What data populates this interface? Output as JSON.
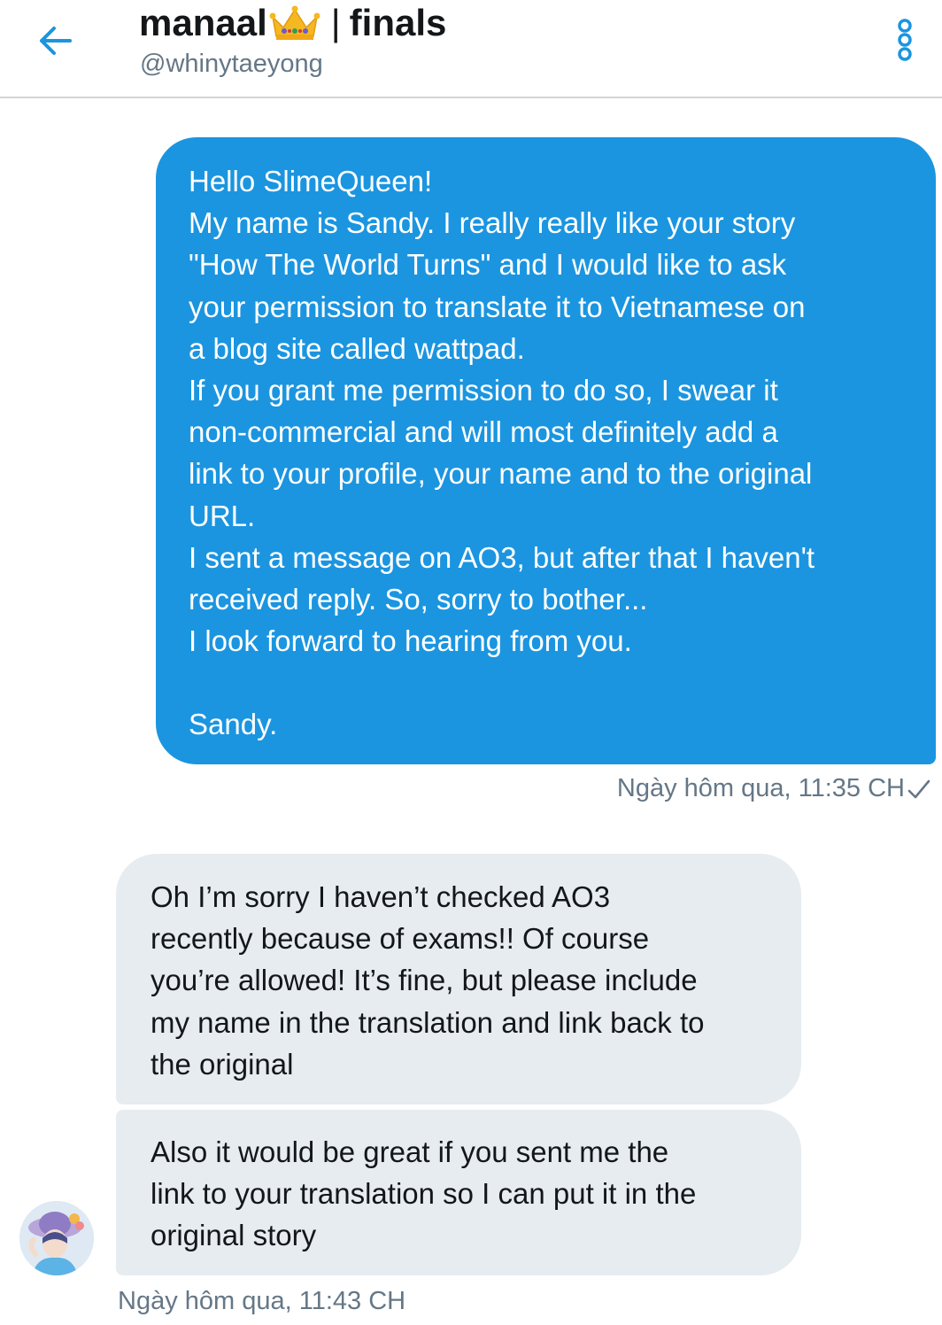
{
  "header": {
    "name": "manaal",
    "name_suffix": "finals",
    "separator": "|",
    "handle": "@whinytaeyong"
  },
  "icons": {
    "back": "arrow-left-icon",
    "crown": "crown-emoji-icon",
    "more": "vertical-dots-icon",
    "read_receipt": "checkmark-icon"
  },
  "colors": {
    "accent": "#1b95e0",
    "received_bubble": "#e6ecf0",
    "muted_text": "#657786"
  },
  "messages": {
    "sent": {
      "lines": [
        "Hello SlimeQueen!",
        "My name is Sandy. I really really like your story",
        "\"How The World Turns\" and I would like to ask",
        "your permission to translate it to Vietnamese on",
        "a blog site called wattpad.",
        "If you grant me permission to do so, I swear it",
        "non-commercial and will most definitely add a",
        "link to your profile, your name and to the original",
        "URL.",
        "I sent a message on AO3, but after that I haven't",
        "received reply. So, sorry to bother...",
        "I look forward to hearing from you.",
        "",
        "Sandy."
      ],
      "timestamp": "Ngày hôm qua, 11:35 CH"
    },
    "received": [
      {
        "lines": [
          "Oh I’m sorry I haven’t checked AO3",
          "recently because of exams!! Of course",
          "you’re allowed! It’s fine, but please include",
          "my name in the translation and link back to",
          "the original"
        ]
      },
      {
        "lines": [
          "Also it would be great if you sent me the",
          "link to your translation so I can put it in the",
          "original story"
        ]
      }
    ],
    "received_timestamp": "Ngày hôm qua, 11:43 CH"
  }
}
